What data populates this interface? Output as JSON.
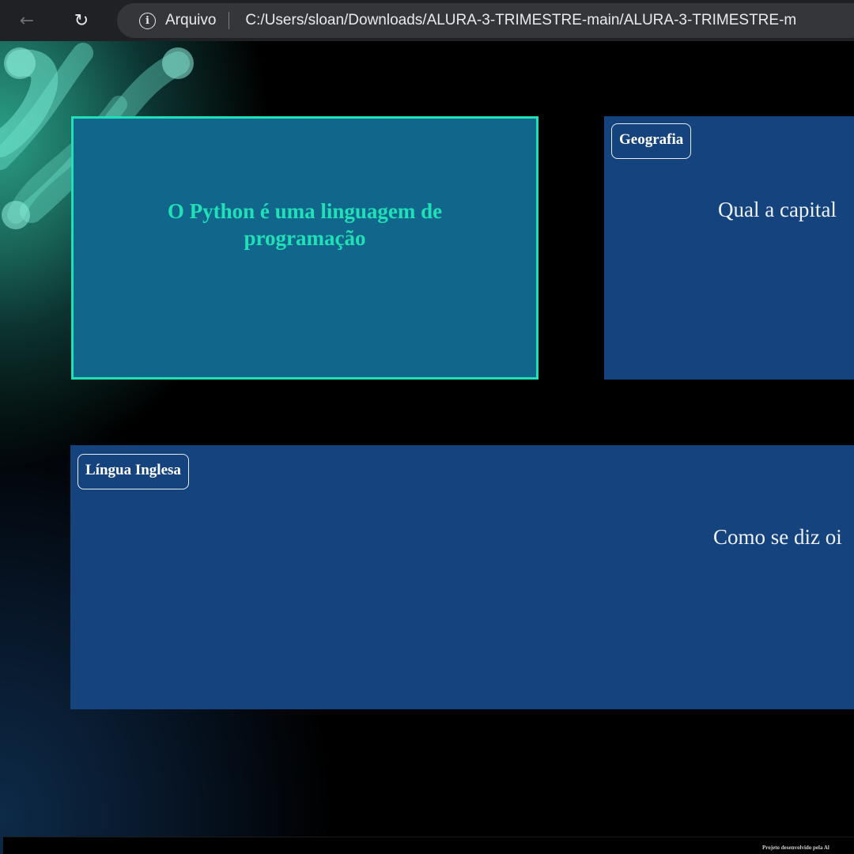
{
  "browser": {
    "back_icon": "←",
    "reload_icon": "↻",
    "info_icon": "i",
    "scheme_label": "Arquivo",
    "url": "C:/Users/sloan/Downloads/ALURA-3-TRIMESTRE-main/ALURA-3-TRIMESTRE-m"
  },
  "flashcards": [
    {
      "tag": "",
      "text": "O Python é uma linguagem de programação"
    },
    {
      "tag": "Geografia",
      "text": "Qual a capital"
    },
    {
      "tag": "Língua Inglesa",
      "text": "Como se diz oi"
    }
  ],
  "footer": {
    "text": "Projeto desenvolvido pela Al"
  },
  "colors": {
    "card_blue": "#14437e",
    "card_python": "#11668c",
    "accent_teal": "#1fe0b6",
    "chrome_bg": "#202124"
  }
}
